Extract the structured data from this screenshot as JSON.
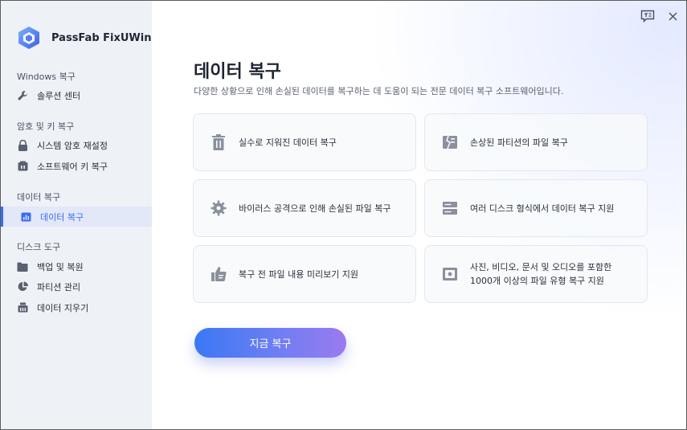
{
  "app": {
    "name": "PassFab FixUWin"
  },
  "topbar": {
    "feedback_icon": "feedback-icon",
    "close_icon": "close-icon"
  },
  "sidebar": {
    "groups": [
      {
        "title": "Windows 복구",
        "items": [
          {
            "label": "솔루션 센터",
            "icon": "wrench-icon"
          }
        ]
      },
      {
        "title": "암호 및 키 복구",
        "items": [
          {
            "label": "시스템 암호 재설정",
            "icon": "lock-icon"
          },
          {
            "label": "소프트웨어 키 복구",
            "icon": "key-box-icon"
          }
        ]
      },
      {
        "title": "데이터 복구",
        "items": [
          {
            "label": "데이터 복구",
            "icon": "bar-chart-icon",
            "active": true
          }
        ]
      },
      {
        "title": "디스크 도구",
        "items": [
          {
            "label": "백업 및 복원",
            "icon": "folder-icon"
          },
          {
            "label": "파티션 관리",
            "icon": "pie-icon"
          },
          {
            "label": "데이터 지우기",
            "icon": "eraser-icon"
          }
        ]
      }
    ]
  },
  "main": {
    "title": "데이터 복구",
    "subtitle": "다양한 상황으로 인해 손실된 데이터를 복구하는 데 도움이 되는 전문 데이터 복구 소프트웨어입니다.",
    "features": [
      {
        "text": "실수로 지워진 데이터 복구",
        "icon": "trash-icon"
      },
      {
        "text": "손상된 파티션의 파일 복구",
        "icon": "damaged-partition-icon"
      },
      {
        "text": "바이러스 공격으로 인해 손실된 파일 복구",
        "icon": "virus-gear-icon"
      },
      {
        "text": "여러 디스크 형식에서 데이터 복구 지원",
        "icon": "disk-icon"
      },
      {
        "text": "복구 전 파일 내용 미리보기 지원",
        "icon": "thumbs-up-icon"
      },
      {
        "text": "사진, 비디오, 문서 및 오디오를 포함한 1000개 이상의 파일 유형 복구 지원",
        "icon": "file-types-icon"
      }
    ],
    "recover_button": "지금 복구"
  },
  "colors": {
    "accent": "#3b6cf3",
    "sidebar_bg": "#eef1f6",
    "icon_gray": "#7f8694"
  }
}
